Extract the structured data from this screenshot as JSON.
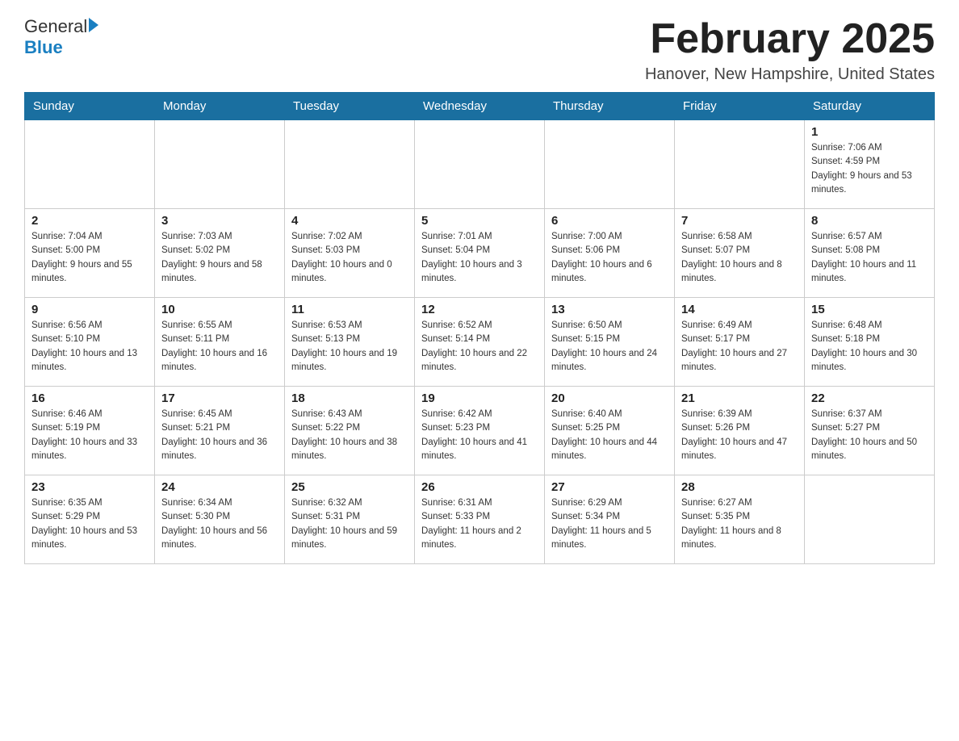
{
  "header": {
    "logo_general": "General",
    "logo_blue": "Blue",
    "title": "February 2025",
    "subtitle": "Hanover, New Hampshire, United States"
  },
  "days_of_week": [
    "Sunday",
    "Monday",
    "Tuesday",
    "Wednesday",
    "Thursday",
    "Friday",
    "Saturday"
  ],
  "weeks": [
    [
      {
        "day": "",
        "info": ""
      },
      {
        "day": "",
        "info": ""
      },
      {
        "day": "",
        "info": ""
      },
      {
        "day": "",
        "info": ""
      },
      {
        "day": "",
        "info": ""
      },
      {
        "day": "",
        "info": ""
      },
      {
        "day": "1",
        "info": "Sunrise: 7:06 AM\nSunset: 4:59 PM\nDaylight: 9 hours and 53 minutes."
      }
    ],
    [
      {
        "day": "2",
        "info": "Sunrise: 7:04 AM\nSunset: 5:00 PM\nDaylight: 9 hours and 55 minutes."
      },
      {
        "day": "3",
        "info": "Sunrise: 7:03 AM\nSunset: 5:02 PM\nDaylight: 9 hours and 58 minutes."
      },
      {
        "day": "4",
        "info": "Sunrise: 7:02 AM\nSunset: 5:03 PM\nDaylight: 10 hours and 0 minutes."
      },
      {
        "day": "5",
        "info": "Sunrise: 7:01 AM\nSunset: 5:04 PM\nDaylight: 10 hours and 3 minutes."
      },
      {
        "day": "6",
        "info": "Sunrise: 7:00 AM\nSunset: 5:06 PM\nDaylight: 10 hours and 6 minutes."
      },
      {
        "day": "7",
        "info": "Sunrise: 6:58 AM\nSunset: 5:07 PM\nDaylight: 10 hours and 8 minutes."
      },
      {
        "day": "8",
        "info": "Sunrise: 6:57 AM\nSunset: 5:08 PM\nDaylight: 10 hours and 11 minutes."
      }
    ],
    [
      {
        "day": "9",
        "info": "Sunrise: 6:56 AM\nSunset: 5:10 PM\nDaylight: 10 hours and 13 minutes."
      },
      {
        "day": "10",
        "info": "Sunrise: 6:55 AM\nSunset: 5:11 PM\nDaylight: 10 hours and 16 minutes."
      },
      {
        "day": "11",
        "info": "Sunrise: 6:53 AM\nSunset: 5:13 PM\nDaylight: 10 hours and 19 minutes."
      },
      {
        "day": "12",
        "info": "Sunrise: 6:52 AM\nSunset: 5:14 PM\nDaylight: 10 hours and 22 minutes."
      },
      {
        "day": "13",
        "info": "Sunrise: 6:50 AM\nSunset: 5:15 PM\nDaylight: 10 hours and 24 minutes."
      },
      {
        "day": "14",
        "info": "Sunrise: 6:49 AM\nSunset: 5:17 PM\nDaylight: 10 hours and 27 minutes."
      },
      {
        "day": "15",
        "info": "Sunrise: 6:48 AM\nSunset: 5:18 PM\nDaylight: 10 hours and 30 minutes."
      }
    ],
    [
      {
        "day": "16",
        "info": "Sunrise: 6:46 AM\nSunset: 5:19 PM\nDaylight: 10 hours and 33 minutes."
      },
      {
        "day": "17",
        "info": "Sunrise: 6:45 AM\nSunset: 5:21 PM\nDaylight: 10 hours and 36 minutes."
      },
      {
        "day": "18",
        "info": "Sunrise: 6:43 AM\nSunset: 5:22 PM\nDaylight: 10 hours and 38 minutes."
      },
      {
        "day": "19",
        "info": "Sunrise: 6:42 AM\nSunset: 5:23 PM\nDaylight: 10 hours and 41 minutes."
      },
      {
        "day": "20",
        "info": "Sunrise: 6:40 AM\nSunset: 5:25 PM\nDaylight: 10 hours and 44 minutes."
      },
      {
        "day": "21",
        "info": "Sunrise: 6:39 AM\nSunset: 5:26 PM\nDaylight: 10 hours and 47 minutes."
      },
      {
        "day": "22",
        "info": "Sunrise: 6:37 AM\nSunset: 5:27 PM\nDaylight: 10 hours and 50 minutes."
      }
    ],
    [
      {
        "day": "23",
        "info": "Sunrise: 6:35 AM\nSunset: 5:29 PM\nDaylight: 10 hours and 53 minutes."
      },
      {
        "day": "24",
        "info": "Sunrise: 6:34 AM\nSunset: 5:30 PM\nDaylight: 10 hours and 56 minutes."
      },
      {
        "day": "25",
        "info": "Sunrise: 6:32 AM\nSunset: 5:31 PM\nDaylight: 10 hours and 59 minutes."
      },
      {
        "day": "26",
        "info": "Sunrise: 6:31 AM\nSunset: 5:33 PM\nDaylight: 11 hours and 2 minutes."
      },
      {
        "day": "27",
        "info": "Sunrise: 6:29 AM\nSunset: 5:34 PM\nDaylight: 11 hours and 5 minutes."
      },
      {
        "day": "28",
        "info": "Sunrise: 6:27 AM\nSunset: 5:35 PM\nDaylight: 11 hours and 8 minutes."
      },
      {
        "day": "",
        "info": ""
      }
    ]
  ]
}
